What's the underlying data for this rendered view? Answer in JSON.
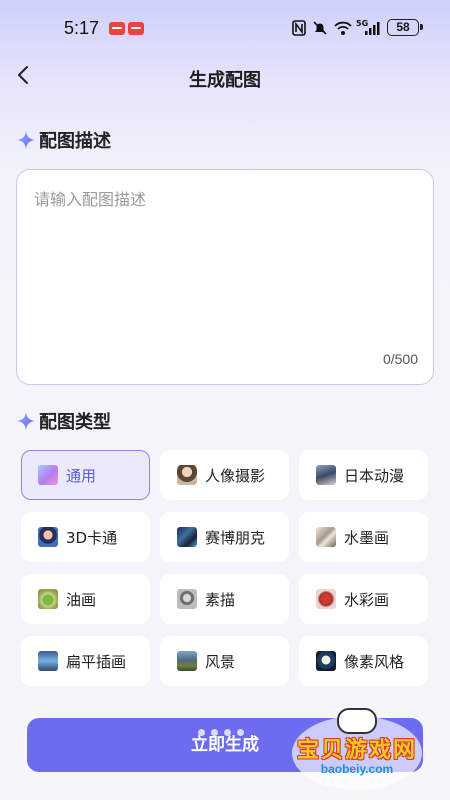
{
  "status_bar": {
    "time": "5:17",
    "signal_label": "5G",
    "battery": "58"
  },
  "header": {
    "back_icon": "chevron-left-icon",
    "title": "生成配图"
  },
  "description_section": {
    "icon": "sparkle-icon",
    "title": "配图描述",
    "placeholder": "请输入配图描述",
    "value": "",
    "char_count": "0/500"
  },
  "type_section": {
    "icon": "sparkle-icon",
    "title": "配图类型",
    "selected": "通用",
    "items": [
      {
        "label": "通用",
        "thumb": "gradient-thumb",
        "selected": true
      },
      {
        "label": "人像摄影",
        "thumb": "portrait-thumb",
        "selected": false
      },
      {
        "label": "日本动漫",
        "thumb": "anime-thumb",
        "selected": false
      },
      {
        "label": "3D卡通",
        "thumb": "cartoon-3d-thumb",
        "selected": false
      },
      {
        "label": "赛博朋克",
        "thumb": "cyberpunk-thumb",
        "selected": false
      },
      {
        "label": "水墨画",
        "thumb": "ink-painting-thumb",
        "selected": false
      },
      {
        "label": "油画",
        "thumb": "oil-painting-thumb",
        "selected": false
      },
      {
        "label": "素描",
        "thumb": "sketch-thumb",
        "selected": false
      },
      {
        "label": "水彩画",
        "thumb": "watercolor-thumb",
        "selected": false
      },
      {
        "label": "扁平插画",
        "thumb": "flat-illustration-thumb",
        "selected": false
      },
      {
        "label": "风景",
        "thumb": "landscape-thumb",
        "selected": false
      },
      {
        "label": "像素风格",
        "thumb": "pixel-style-thumb",
        "selected": false
      }
    ]
  },
  "footer": {
    "generate_label": "立即生成",
    "accent_color": "#6d6cf1"
  },
  "watermark": {
    "title": "宝贝游戏网",
    "url": "baobeiy.com"
  }
}
